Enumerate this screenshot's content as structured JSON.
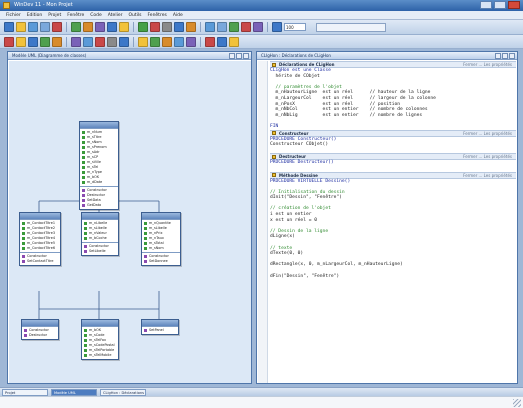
{
  "window": {
    "title": "WinDev 11 - Mon Projet"
  },
  "menu": [
    "Fichier",
    "Edition",
    "Projet",
    "Fenêtre",
    "Code",
    "Atelier",
    "Outils",
    "Fenêtres",
    "Aide"
  ],
  "toolbar1": {
    "icons": [
      "new-icon",
      "open-icon",
      "save-icon",
      "print-icon",
      "cut-icon",
      "copy-icon",
      "paste-icon",
      "undo-icon",
      "redo-icon",
      "find-icon",
      "run-icon",
      "debug-icon",
      "stop-icon",
      "compile-icon",
      "project-icon",
      "analysis-icon",
      "window-icon",
      "report-icon",
      "query-icon",
      "code-icon",
      "help-icon"
    ],
    "colors": [
      "#3d78c8",
      "#f2c23a",
      "#5a9ad8",
      "#7aa8dc",
      "#c94848",
      "#4fa04f",
      "#d88b2b",
      "#7a62b8",
      "#3d78c8",
      "#f2c23a",
      "#46a046",
      "#c94848",
      "#8a8a8a",
      "#3d78c8",
      "#d88b2b",
      "#5a9ad8",
      "#7aa8dc",
      "#4fa04f",
      "#c94848",
      "#7a62b8",
      "#3d78c8"
    ],
    "zoom": "100"
  },
  "toolbar2": {
    "icons": [
      "uml-icon",
      "class-icon",
      "association-icon",
      "aggregation-icon",
      "composition-icon",
      "inherit-icon",
      "note-icon",
      "link-icon",
      "grid-icon",
      "align-icon",
      "zoom-in-icon",
      "zoom-out-icon",
      "layout-icon",
      "export-icon",
      "properties-icon",
      "refresh-icon",
      "options-icon",
      "colors-icon"
    ],
    "colors": [
      "#c94848",
      "#f2c23a",
      "#3d78c8",
      "#4fa04f",
      "#d88b2b",
      "#7a62b8",
      "#5a9ad8",
      "#c94848",
      "#8a8a8a",
      "#3d78c8",
      "#f2c23a",
      "#4fa04f",
      "#d88b2b",
      "#5a9ad8",
      "#7a62b8",
      "#c94848",
      "#3d78c8",
      "#f2c23a"
    ]
  },
  "left_pane": {
    "title": "Modèle UML (Diagramme de classes)"
  },
  "right_pane": {
    "title": "CLIgHon : Déclarations de CLigHon"
  },
  "classes": [
    {
      "fields": [
        "m_nNum",
        "m_sTitre",
        "m_sNom",
        "m_sPrenom",
        "m_sAdr",
        "m_sCP",
        "m_sVille",
        "m_sTel",
        "m_nType",
        "m_bOK",
        "m_dDate"
      ],
      "methods": [
        "Constructor",
        "Destructor",
        "SetData",
        "GetData"
      ]
    },
    {
      "fields": [
        "m_ContactTitre1",
        "m_ContactTitre2",
        "m_ContactTitre3",
        "m_ContactTitre4",
        "m_ContactTitre5",
        "m_ContactTitre6"
      ],
      "methods": [
        "Constructor",
        "SetContactTitre"
      ]
    },
    {
      "fields": [
        "m_nLibelle",
        "m_sLibelle",
        "m_nValeur",
        "m_bCoche"
      ],
      "methods": [
        "Constructor",
        "SetLibelle"
      ]
    },
    {
      "fields": [
        "m_nQuantite",
        "m_sLibelle",
        "m_nPrix",
        "m_nTaux",
        "m_sTotal",
        "m_sNom"
      ],
      "methods": [
        "Constructor",
        "SetDonnee"
      ]
    },
    {
      "fields": [],
      "methods": [
        "Constructor",
        "Destructor"
      ]
    },
    {
      "fields": [
        "m_bOK",
        "m_sCode",
        "m_sTelFax",
        "m_sCodePostal",
        "m_sTelPortable",
        "m_sTelMobile"
      ],
      "methods": []
    },
    {
      "fields": [],
      "methods": [
        "SetPanel"
      ]
    }
  ],
  "code": {
    "sections": [
      {
        "title": "Déclarations de CLigHon",
        "link": "Fermer ... Les propriétés",
        "lines": [
          {
            "t": "CLigHon est une Classe",
            "c": "kw"
          },
          {
            "t": "  hérite de CObjet",
            "c": ""
          },
          {
            "t": "",
            "c": ""
          },
          {
            "t": "  // paramètres de l'objet",
            "c": "cm"
          },
          {
            "t": "  m_nHauteurLigne  est un réel      // hauteur de la ligne",
            "c": ""
          },
          {
            "t": "  m_nLargeurCol    est un réel      // largeur de la colonne",
            "c": ""
          },
          {
            "t": "  m_nPosX          est un réel      // position",
            "c": ""
          },
          {
            "t": "  m_nNbCol         est un entier    // nombre de colonnes",
            "c": ""
          },
          {
            "t": "  m_nNbLig         est un entier    // nombre de lignes",
            "c": ""
          },
          {
            "t": "",
            "c": ""
          },
          {
            "t": "FIN",
            "c": "kw"
          }
        ]
      },
      {
        "title": "Constructeur",
        "link": "Fermer ... Les propriétés",
        "lines": [
          {
            "t": "PROCEDURE Constructeur()",
            "c": "kw"
          },
          {
            "t": "Constructeur CObjet()",
            "c": ""
          },
          {
            "t": "",
            "c": ""
          }
        ]
      },
      {
        "title": "Destructeur",
        "link": "Fermer ... Les propriétés",
        "lines": [
          {
            "t": "PROCEDURE Destructeur()",
            "c": "kw"
          },
          {
            "t": "",
            "c": ""
          }
        ]
      },
      {
        "title": "Méthode Dessine",
        "link": "Fermer ... Les propriétés",
        "lines": [
          {
            "t": "PROCEDURE VIRTUELLE Dessine()",
            "c": "kw"
          },
          {
            "t": "",
            "c": ""
          },
          {
            "t": "// Initialisation du dessin",
            "c": "cm"
          },
          {
            "t": "dInit(\"Dessin\", \"Fenêtre\")",
            "c": ""
          },
          {
            "t": "",
            "c": ""
          },
          {
            "t": "// création de l'objet",
            "c": "cm"
          },
          {
            "t": "i est un entier",
            "c": ""
          },
          {
            "t": "x est un réel = 0",
            "c": ""
          },
          {
            "t": "",
            "c": ""
          },
          {
            "t": "// Dessin de la ligne",
            "c": "cm"
          },
          {
            "t": "dLigne(x)",
            "c": ""
          },
          {
            "t": "",
            "c": ""
          },
          {
            "t": "// texte",
            "c": "cm"
          },
          {
            "t": "dTexte(0, 0)",
            "c": ""
          },
          {
            "t": "",
            "c": ""
          },
          {
            "t": "dRectangle(x, 0, m_nLargeurCol, m_nHauteurLigne)",
            "c": ""
          },
          {
            "t": "",
            "c": ""
          },
          {
            "t": "dFin(\"Dessin\", \"Fenêtre\")",
            "c": ""
          }
        ]
      }
    ]
  },
  "status_tabs": [
    {
      "label": "Projet",
      "active": false
    },
    {
      "label": "Modèle UML",
      "active": true
    },
    {
      "label": "CLigHon : Déclarations",
      "active": false
    }
  ]
}
